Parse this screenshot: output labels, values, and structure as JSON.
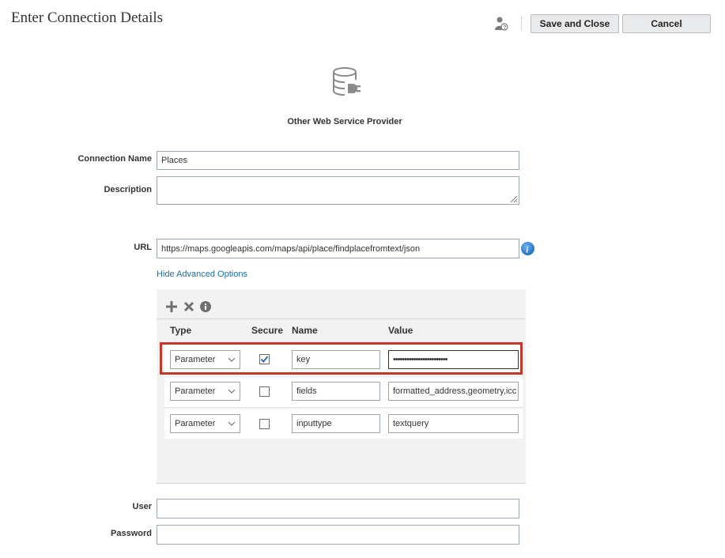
{
  "header": {
    "title": "Enter Connection Details",
    "save_label": "Save and Close",
    "cancel_label": "Cancel",
    "help_icon": "user-help-icon"
  },
  "provider": {
    "icon": "database-plug-icon",
    "name": "Other Web Service Provider"
  },
  "form": {
    "connection_name_label": "Connection Name",
    "connection_name_value": "Places",
    "description_label": "Description",
    "description_value": "",
    "url_label": "URL",
    "url_value": "https://maps.googleapis.com/maps/api/place/findplacefromtext/json",
    "advanced_link": "Hide Advanced Options",
    "user_label": "User",
    "user_value": "",
    "password_label": "Password",
    "password_value": ""
  },
  "params": {
    "columns": [
      "Type",
      "Secure",
      "Name",
      "Value"
    ],
    "rows": [
      {
        "type": "Parameter",
        "secure": true,
        "name": "key",
        "value": "••••••••••••••••••••••••"
      },
      {
        "type": "Parameter",
        "secure": false,
        "name": "fields",
        "value": "formatted_address,geometry,icc"
      },
      {
        "type": "Parameter",
        "secure": false,
        "name": "inputtype",
        "value": "textquery"
      }
    ]
  },
  "colors": {
    "highlight": "#c0392b",
    "link": "#1c6ca3",
    "info": "#2a7dd1"
  }
}
